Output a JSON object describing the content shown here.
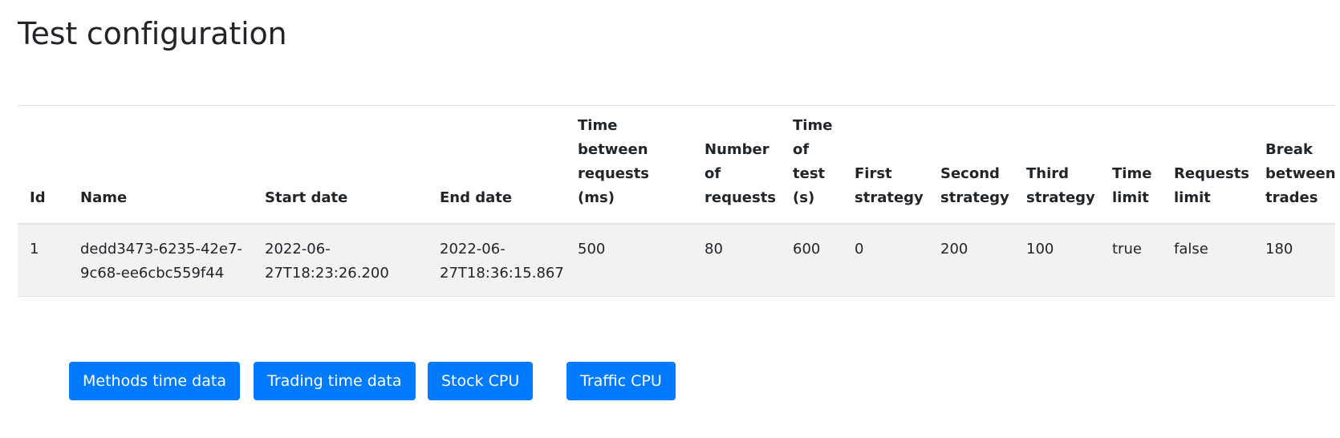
{
  "page": {
    "title": "Test configuration"
  },
  "table": {
    "headers": [
      "Id",
      "Name",
      "Start date",
      "End date",
      "Time between requests (ms)",
      "Number of requests",
      "Time of test (s)",
      "First strategy",
      "Second strategy",
      "Third strategy",
      "Time limit",
      "Requests limit",
      "Break between trades"
    ],
    "rows": [
      [
        "1",
        "dedd3473-6235-42e7-9c68-ee6cbc559f44",
        "2022-06-27T18:23:26.200",
        "2022-06-27T18:36:15.867",
        "500",
        "80",
        "600",
        "0",
        "200",
        "100",
        "true",
        "false",
        "180"
      ]
    ]
  },
  "buttons": {
    "methods_time_data": "Methods time data",
    "trading_time_data": "Trading time data",
    "stock_cpu": "Stock CPU",
    "traffic_cpu": "Traffic CPU"
  },
  "colors": {
    "primary_button": "#007bff",
    "row_background": "#f2f2f2",
    "border": "#dee2e6",
    "text": "#212529"
  }
}
